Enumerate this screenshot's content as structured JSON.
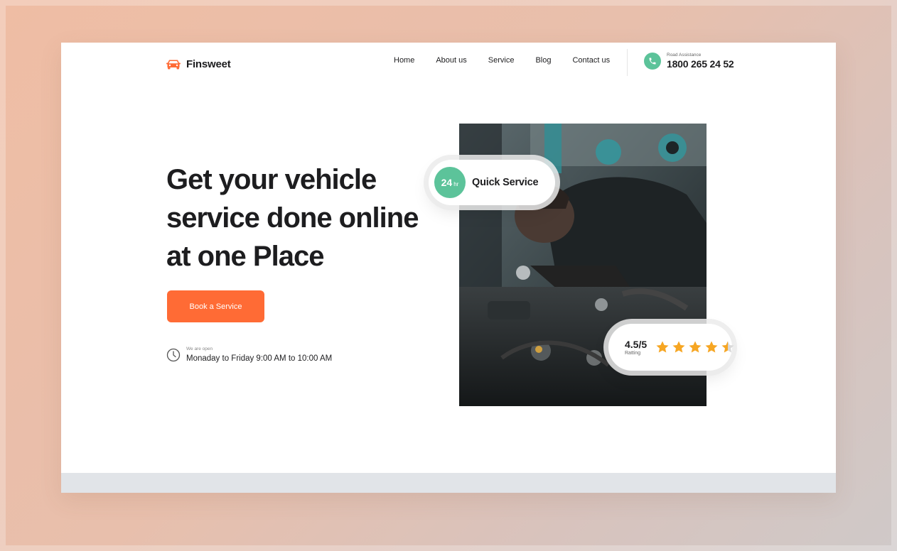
{
  "header": {
    "brand": "Finsweet",
    "nav": [
      "Home",
      "About us",
      "Service",
      "Blog",
      "Contact us"
    ],
    "phone_caption": "Road Assistance",
    "phone_number": "1800 265 24 52"
  },
  "hero": {
    "title_lines": [
      "Get your vehicle",
      "service done online",
      "at one Place"
    ],
    "cta_label": "Book a Service",
    "hours_caption": "We are open",
    "hours_text": "Monaday to Friday 9:00 AM to  10:00 AM"
  },
  "badges": {
    "quick_number": "24",
    "quick_unit": "hr",
    "quick_label": "Quick Service",
    "rating_value": "4.5/5",
    "rating_caption": "Ratting",
    "rating_stars": 4.5,
    "rating_max": 5
  },
  "colors": {
    "accent": "#ff6b35",
    "green": "#5cc39a",
    "star": "#f6a623",
    "text": "#1d1d1f"
  },
  "icons": {
    "logo": "car-icon",
    "phone": "phone-icon",
    "clock": "clock-icon",
    "rating": "star-icon"
  }
}
